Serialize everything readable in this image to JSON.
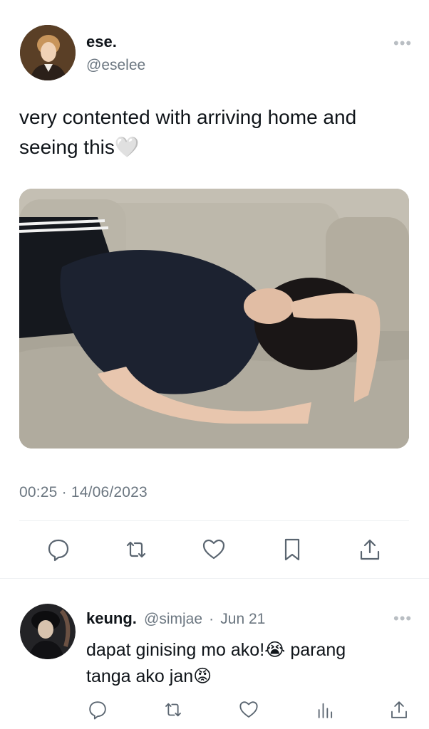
{
  "tweet": {
    "author_name": "ese.",
    "author_handle": "@eselee",
    "text": "very contented with arriving home and seeing this🤍",
    "timestamp": "00:25 · 14/06/2023",
    "more_icon": "more-dots-icon",
    "actions": [
      "reply-icon",
      "retweet-icon",
      "like-icon",
      "bookmark-icon",
      "share-icon"
    ]
  },
  "reply": {
    "author_name": "keung.",
    "author_handle": "@simjae",
    "separator": "·",
    "date": "Jun 21",
    "text": "dapat ginising mo ako!😭 parang tanga ako jan😡",
    "actions": [
      "reply-icon",
      "retweet-icon",
      "like-icon",
      "analytics-icon",
      "share-icon"
    ]
  },
  "colors": {
    "text": "#0f1419",
    "muted": "#6b7680",
    "icon": "#5a6570",
    "divider": "#eef1f3"
  }
}
